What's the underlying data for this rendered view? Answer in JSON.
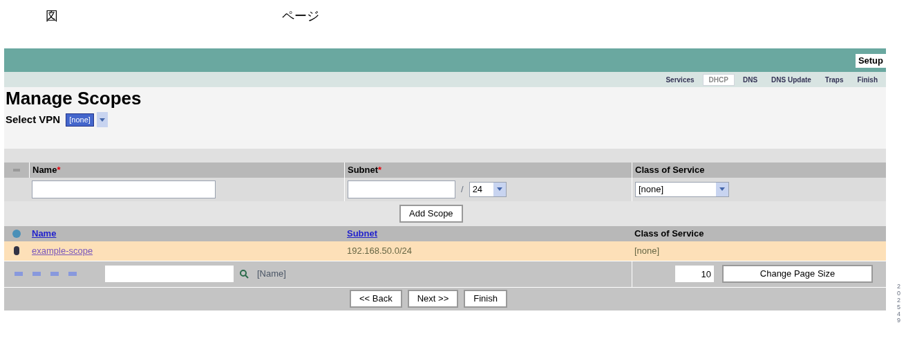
{
  "caption": {
    "figure_mark": "図",
    "page_word": "ページ"
  },
  "header": {
    "title": "Setup"
  },
  "tabs": [
    {
      "label": "Services",
      "selected": false
    },
    {
      "label": "DHCP",
      "selected": true
    },
    {
      "label": "DNS",
      "selected": false
    },
    {
      "label": "DNS Update",
      "selected": false
    },
    {
      "label": "Traps",
      "selected": false
    },
    {
      "label": "Finish",
      "selected": false
    }
  ],
  "page_title": "Manage Scopes",
  "vpn": {
    "label": "Select VPN",
    "value": "[none]"
  },
  "add_form": {
    "columns": [
      {
        "label": "Name",
        "required": true
      },
      {
        "label": "Subnet",
        "required": true
      },
      {
        "label": "Class of Service",
        "required": false
      }
    ],
    "required_mark": "*",
    "mask": "24",
    "separator": "/",
    "class_of_service": "[none]",
    "button": "Add Scope"
  },
  "table": {
    "columns": [
      {
        "label": "Name",
        "link": true
      },
      {
        "label": "Subnet",
        "link": true
      },
      {
        "label": "Class of Service",
        "link": false
      }
    ],
    "rows": [
      {
        "name": "example-scope",
        "subnet": "192.168.50.0/24",
        "class_of_service": "[none]"
      }
    ]
  },
  "pager": {
    "filter_field": "[Name]",
    "page_size": "10",
    "button": "Change Page Size"
  },
  "buttons": [
    "<< Back",
    "Next >>",
    "Finish"
  ],
  "figure_id": "202549"
}
